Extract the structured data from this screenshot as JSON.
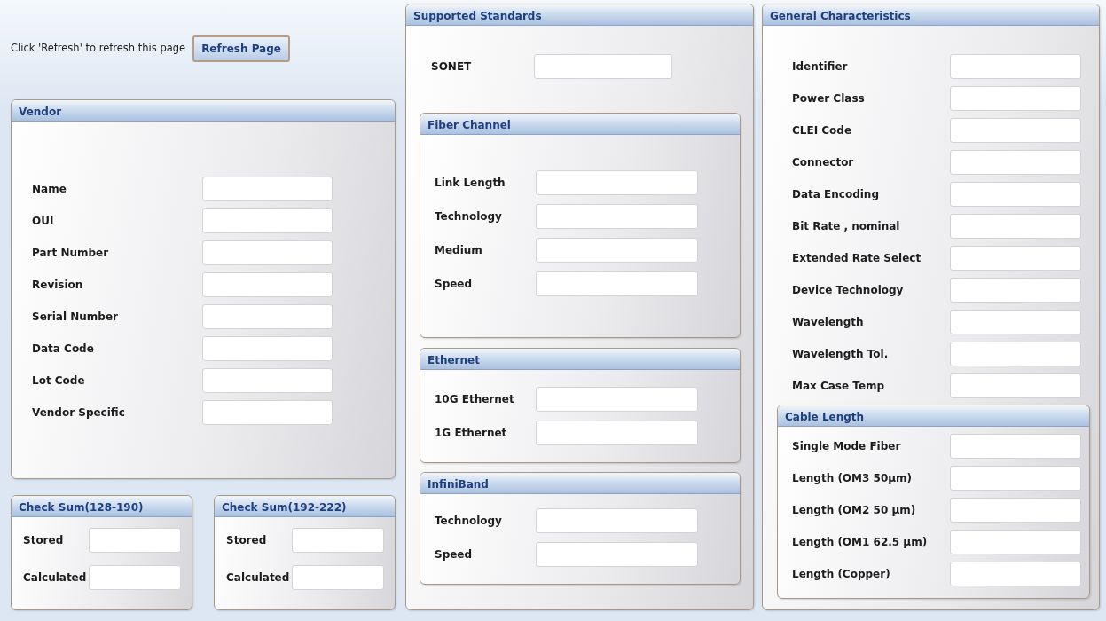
{
  "refresh": {
    "prompt": "Click 'Refresh' to refresh this page",
    "button": "Refresh Page"
  },
  "vendor": {
    "title": "Vendor",
    "fields": [
      {
        "label": "Name"
      },
      {
        "label": "OUI"
      },
      {
        "label": "Part Number"
      },
      {
        "label": "Revision"
      },
      {
        "label": "Serial Number"
      },
      {
        "label": "Data Code"
      },
      {
        "label": "Lot Code"
      },
      {
        "label": "Vendor Specific"
      }
    ]
  },
  "checksums": [
    {
      "title": "Check Sum(128-190)",
      "fields": [
        {
          "label": "Stored"
        },
        {
          "label": "Calculated"
        }
      ]
    },
    {
      "title": "Check Sum(192-222)",
      "fields": [
        {
          "label": "Stored"
        },
        {
          "label": "Calculated"
        }
      ]
    }
  ],
  "supported_standards": {
    "title": "Supported Standards",
    "fields": [
      {
        "label": "SONET"
      }
    ],
    "groups": [
      {
        "title": "Fiber Channel",
        "fields": [
          {
            "label": "Link Length"
          },
          {
            "label": "Technology"
          },
          {
            "label": "Medium"
          },
          {
            "label": "Speed"
          }
        ]
      },
      {
        "title": "Ethernet",
        "fields": [
          {
            "label": "10G Ethernet"
          },
          {
            "label": "1G Ethernet"
          }
        ]
      },
      {
        "title": "InfiniBand",
        "fields": [
          {
            "label": "Technology"
          },
          {
            "label": "Speed"
          }
        ]
      }
    ]
  },
  "general_characteristics": {
    "title": "General Characteristics",
    "fields": [
      {
        "label": "Identifier"
      },
      {
        "label": "Power Class"
      },
      {
        "label": "CLEI Code"
      },
      {
        "label": "Connector"
      },
      {
        "label": "Data Encoding"
      },
      {
        "label": "Bit Rate , nominal"
      },
      {
        "label": "Extended Rate Select"
      },
      {
        "label": "Device Technology"
      },
      {
        "label": "Wavelength"
      },
      {
        "label": "Wavelength Tol."
      },
      {
        "label": "Max Case Temp"
      }
    ],
    "groups": [
      {
        "title": "Cable Length",
        "fields": [
          {
            "label": "Single Mode Fiber"
          },
          {
            "label": "Length (OM3 50µm)"
          },
          {
            "label": "Length (OM2 50 µm)"
          },
          {
            "label": "Length (OM1 62.5 µm)"
          },
          {
            "label": "Length (Copper)"
          }
        ]
      }
    ]
  }
}
